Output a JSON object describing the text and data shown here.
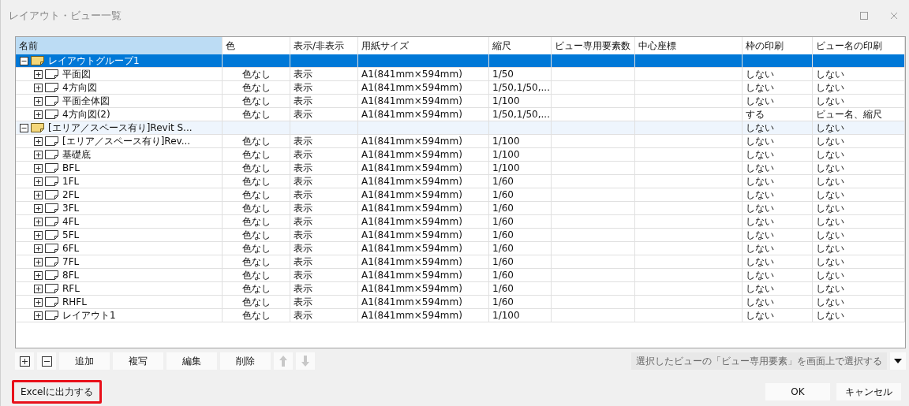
{
  "window": {
    "title": "レイアウト・ビュー一覧",
    "controls": [
      {
        "kind": "maximize"
      },
      {
        "kind": "close"
      }
    ]
  },
  "table": {
    "columns": [
      {
        "label": "名前",
        "selected": true
      },
      {
        "label": "色",
        "selected": false
      },
      {
        "label": "表示/非表示",
        "selected": false
      },
      {
        "label": "用紙サイズ",
        "selected": false
      },
      {
        "label": "縮尺",
        "selected": false
      },
      {
        "label": "ビュー専用要素数",
        "selected": false
      },
      {
        "label": "中心座標",
        "selected": false
      },
      {
        "label": "枠の印刷",
        "selected": false
      },
      {
        "label": "ビュー名の印刷",
        "selected": false
      }
    ],
    "rows": [
      {
        "kind": "group",
        "name": "レイアウトグループ1",
        "expanded": true,
        "selected": true,
        "hovered": false,
        "children": [
          {
            "kind": "view",
            "name": "平面図",
            "expanded": false,
            "selected": false,
            "hovered": false,
            "color_setting": "色なし",
            "visibility": "表示",
            "paper_size": "A1(841mm×594mm)",
            "scale": "1/50",
            "frame_print": "しない",
            "name_print": "しない"
          },
          {
            "kind": "view",
            "name": "4方向図",
            "expanded": false,
            "selected": false,
            "hovered": false,
            "color_setting": "色なし",
            "visibility": "表示",
            "paper_size": "A1(841mm×594mm)",
            "scale": "1/50,1/50,...",
            "frame_print": "しない",
            "name_print": "しない"
          },
          {
            "kind": "view",
            "name": "平面全体図",
            "expanded": false,
            "selected": false,
            "hovered": false,
            "color_setting": "色なし",
            "visibility": "表示",
            "paper_size": "A1(841mm×594mm)",
            "scale": "1/100",
            "frame_print": "しない",
            "name_print": "しない"
          },
          {
            "kind": "view",
            "name": "4方向図(2)",
            "expanded": false,
            "selected": false,
            "hovered": false,
            "color_setting": "色なし",
            "visibility": "表示",
            "paper_size": "A1(841mm×594mm)",
            "scale": "1/50,1/50,...",
            "frame_print": "する",
            "name_print": "ビュー名、縮尺"
          }
        ]
      },
      {
        "kind": "group",
        "name": "[エリア／スペース有り]Revit S...",
        "expanded": true,
        "selected": false,
        "hovered": true,
        "frame_print": "しない",
        "name_print": "しない",
        "children": [
          {
            "kind": "view",
            "name": "[エリア／スペース有り]Rev...",
            "expanded": false,
            "selected": false,
            "hovered": false,
            "color_setting": "色なし",
            "visibility": "表示",
            "paper_size": "A1(841mm×594mm)",
            "scale": "1/100",
            "frame_print": "しない",
            "name_print": "しない"
          },
          {
            "kind": "view",
            "name": "基礎底",
            "expanded": false,
            "selected": false,
            "hovered": false,
            "color_setting": "色なし",
            "visibility": "表示",
            "paper_size": "A1(841mm×594mm)",
            "scale": "1/100",
            "frame_print": "しない",
            "name_print": "しない"
          },
          {
            "kind": "view",
            "name": "BFL",
            "expanded": false,
            "selected": false,
            "hovered": false,
            "color_setting": "色なし",
            "visibility": "表示",
            "paper_size": "A1(841mm×594mm)",
            "scale": "1/100",
            "frame_print": "しない",
            "name_print": "しない"
          },
          {
            "kind": "view",
            "name": "1FL",
            "expanded": false,
            "selected": false,
            "hovered": false,
            "color_setting": "色なし",
            "visibility": "表示",
            "paper_size": "A1(841mm×594mm)",
            "scale": "1/60",
            "frame_print": "しない",
            "name_print": "しない"
          },
          {
            "kind": "view",
            "name": "2FL",
            "expanded": false,
            "selected": false,
            "hovered": false,
            "color_setting": "色なし",
            "visibility": "表示",
            "paper_size": "A1(841mm×594mm)",
            "scale": "1/60",
            "frame_print": "しない",
            "name_print": "しない"
          },
          {
            "kind": "view",
            "name": "3FL",
            "expanded": false,
            "selected": false,
            "hovered": false,
            "color_setting": "色なし",
            "visibility": "表示",
            "paper_size": "A1(841mm×594mm)",
            "scale": "1/60",
            "frame_print": "しない",
            "name_print": "しない"
          },
          {
            "kind": "view",
            "name": "4FL",
            "expanded": false,
            "selected": false,
            "hovered": false,
            "color_setting": "色なし",
            "visibility": "表示",
            "paper_size": "A1(841mm×594mm)",
            "scale": "1/60",
            "frame_print": "しない",
            "name_print": "しない"
          },
          {
            "kind": "view",
            "name": "5FL",
            "expanded": false,
            "selected": false,
            "hovered": false,
            "color_setting": "色なし",
            "visibility": "表示",
            "paper_size": "A1(841mm×594mm)",
            "scale": "1/60",
            "frame_print": "しない",
            "name_print": "しない"
          },
          {
            "kind": "view",
            "name": "6FL",
            "expanded": false,
            "selected": false,
            "hovered": false,
            "color_setting": "色なし",
            "visibility": "表示",
            "paper_size": "A1(841mm×594mm)",
            "scale": "1/60",
            "frame_print": "しない",
            "name_print": "しない"
          },
          {
            "kind": "view",
            "name": "7FL",
            "expanded": false,
            "selected": false,
            "hovered": false,
            "color_setting": "色なし",
            "visibility": "表示",
            "paper_size": "A1(841mm×594mm)",
            "scale": "1/60",
            "frame_print": "しない",
            "name_print": "しない"
          },
          {
            "kind": "view",
            "name": "8FL",
            "expanded": false,
            "selected": false,
            "hovered": false,
            "color_setting": "色なし",
            "visibility": "表示",
            "paper_size": "A1(841mm×594mm)",
            "scale": "1/60",
            "frame_print": "しない",
            "name_print": "しない"
          },
          {
            "kind": "view",
            "name": "RFL",
            "expanded": false,
            "selected": false,
            "hovered": false,
            "color_setting": "色なし",
            "visibility": "表示",
            "paper_size": "A1(841mm×594mm)",
            "scale": "1/60",
            "frame_print": "しない",
            "name_print": "しない"
          },
          {
            "kind": "view",
            "name": "RHFL",
            "expanded": false,
            "selected": false,
            "hovered": false,
            "color_setting": "色なし",
            "visibility": "表示",
            "paper_size": "A1(841mm×594mm)",
            "scale": "1/60",
            "frame_print": "しない",
            "name_print": "しない"
          },
          {
            "kind": "view",
            "name": "レイアウト1",
            "expanded": false,
            "selected": false,
            "hovered": false,
            "color_setting": "色なし",
            "visibility": "表示",
            "paper_size": "A1(841mm×594mm)",
            "scale": "1/100",
            "frame_print": "しない",
            "name_print": "しない"
          }
        ]
      }
    ]
  },
  "toolbar": {
    "tree_buttons": [
      {
        "kind": "expand_all"
      },
      {
        "kind": "collapse_all"
      }
    ],
    "buttons": [
      "追加",
      "複写",
      "編集",
      "削除"
    ],
    "arrows": [
      {
        "kind": "up",
        "disabled": true
      },
      {
        "kind": "down",
        "disabled": true
      }
    ],
    "select_action": "選択したビューの「ビュー専用要素」を画面上で選択する"
  },
  "footer": {
    "export_button": {
      "label": "Excelに出力する",
      "highlighted": true
    },
    "buttons": [
      "OK",
      "キャンセル"
    ]
  }
}
